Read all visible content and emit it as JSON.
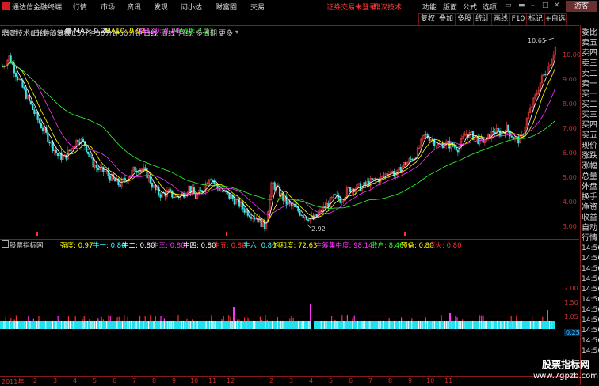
{
  "app": {
    "name": "通达信金融终端",
    "menus": [
      "行情",
      "市场",
      "资讯",
      "发现",
      "问小达",
      "财富圈",
      "交易"
    ],
    "notice": "证券交易未登录",
    "stock_link": "鼎汉技术",
    "right_menus": [
      "功能",
      "版面",
      "公式",
      "选项"
    ],
    "guest_button": "游客"
  },
  "periods": [
    "分时",
    "1分钟",
    "5分钟",
    "15分钟",
    "30分钟",
    "60分钟",
    "日线",
    "周线",
    "月线",
    "多周期",
    "更多"
  ],
  "active_period": "日线",
  "toolbar": [
    "复权",
    "叠加",
    "多股",
    "统计",
    "画线",
    "F10",
    "标记",
    "+自选"
  ],
  "chart_title": "鼎汉技术(日线 前复权)",
  "ma_readouts": [
    {
      "label": "MA5: 9.28",
      "color": "#ffffff"
    },
    {
      "label": "MA10: 9.03",
      "color": "#ffff00"
    },
    {
      "label": "MA20: 8.59",
      "color": "#ff33ff"
    },
    {
      "label": "MA60: 7.27",
      "color": "#33ff33"
    }
  ],
  "price_axis": [
    "10.00",
    "9.00",
    "8.00",
    "7.00",
    "6.00",
    "5.00",
    "4.00",
    "3.00"
  ],
  "annotations": {
    "high": "10.65",
    "low": "2.92"
  },
  "indicator": {
    "name": "股票指标网",
    "items": [
      {
        "label": "强度: 0.97",
        "color": "#ffff00"
      },
      {
        "label": "牛一: 0.80",
        "color": "#33ffff"
      },
      {
        "label": "牛二: 0.80",
        "color": "#ffffff"
      },
      {
        "label": "牛三: 0.80",
        "color": "#ff33ff"
      },
      {
        "label": "牛四: 0.80",
        "color": "#ffffff"
      },
      {
        "label": "牛五: 0.80",
        "color": "#ff3333"
      },
      {
        "label": "牛六: 0.80",
        "color": "#33ffff"
      },
      {
        "label": "饱和度: 72.63",
        "color": "#ffff00"
      },
      {
        "label": "主筹集中度: 98.14",
        "color": "#ff33ff"
      },
      {
        "label": "散户: 8.46",
        "color": "#33ff33"
      },
      {
        "label": "预备: 0.80",
        "color": "#ffff00"
      },
      {
        "label": "点火: 0.80",
        "color": "#ff3333"
      }
    ],
    "scale": [
      "2.00",
      "1.50",
      "1.05",
      "0.25"
    ]
  },
  "time_axis": [
    "2011年",
    "2",
    "3",
    "4",
    "5",
    "6",
    "7",
    "8",
    "9",
    "10",
    "11",
    "12",
    "2",
    "3",
    "4",
    "5",
    "6",
    "7",
    "8",
    "9",
    "10",
    "11"
  ],
  "right_column": [
    "委比",
    "卖五",
    "卖四",
    "卖三",
    "卖二",
    "卖一",
    "买一",
    "买二",
    "买三",
    "买四",
    "买五",
    "现价",
    "涨跌",
    "涨幅",
    "总量",
    "外盘",
    "换手",
    "净资",
    "收益",
    "自动",
    "行情",
    "14:56",
    "14:56",
    "14:56",
    "14:56",
    "14:56",
    "14:56",
    "14:56",
    "14:56",
    "14:56",
    "14:56",
    "14:56"
  ],
  "watermark": {
    "line1": "股票指标网",
    "line2": "www.7gpzb.com"
  },
  "chart_data": {
    "type": "candlestick",
    "period": "日线",
    "y_axis_ticks": [
      3.0,
      4.0,
      5.0,
      6.0,
      7.0,
      8.0,
      9.0,
      10.0
    ],
    "ylim": [
      2.7,
      10.8
    ],
    "annotated_high": 10.65,
    "annotated_low": 2.92,
    "ma_values": {
      "MA5": 9.28,
      "MA10": 9.03,
      "MA20": 8.59,
      "MA60": 7.27
    },
    "close_trend": [
      9.5,
      9.9,
      9.2,
      8.6,
      8.0,
      7.4,
      6.9,
      6.4,
      5.9,
      5.8,
      6.2,
      6.6,
      6.3,
      5.6,
      5.3,
      5.2,
      4.9,
      4.7,
      5.0,
      5.3,
      5.4,
      5.1,
      4.5,
      4.3,
      4.4,
      4.2,
      4.3,
      4.6,
      4.2,
      4.5,
      5.1,
      4.6,
      4.4,
      4.2,
      4.0,
      3.7,
      3.5,
      3.3,
      3.0,
      4.8,
      4.4,
      4.0,
      3.8,
      3.6,
      3.4,
      3.3,
      3.6,
      3.9,
      4.2,
      4.1,
      4.5,
      4.6,
      4.6,
      4.8,
      4.9,
      5.0,
      5.3,
      5.1,
      5.5,
      5.7,
      6.0,
      6.7,
      6.6,
      6.3,
      6.4,
      6.3,
      6.2,
      6.8,
      6.7,
      6.5,
      6.5,
      6.9,
      6.8,
      7.0,
      6.6,
      6.5,
      7.5,
      8.2,
      9.0,
      9.5,
      10.3
    ],
    "series": [
      {
        "name": "MA5",
        "color": "#ffffff"
      },
      {
        "name": "MA10",
        "color": "#ffff00"
      },
      {
        "name": "MA20",
        "color": "#ff33ff"
      },
      {
        "name": "MA60",
        "color": "#33ff33"
      }
    ]
  }
}
